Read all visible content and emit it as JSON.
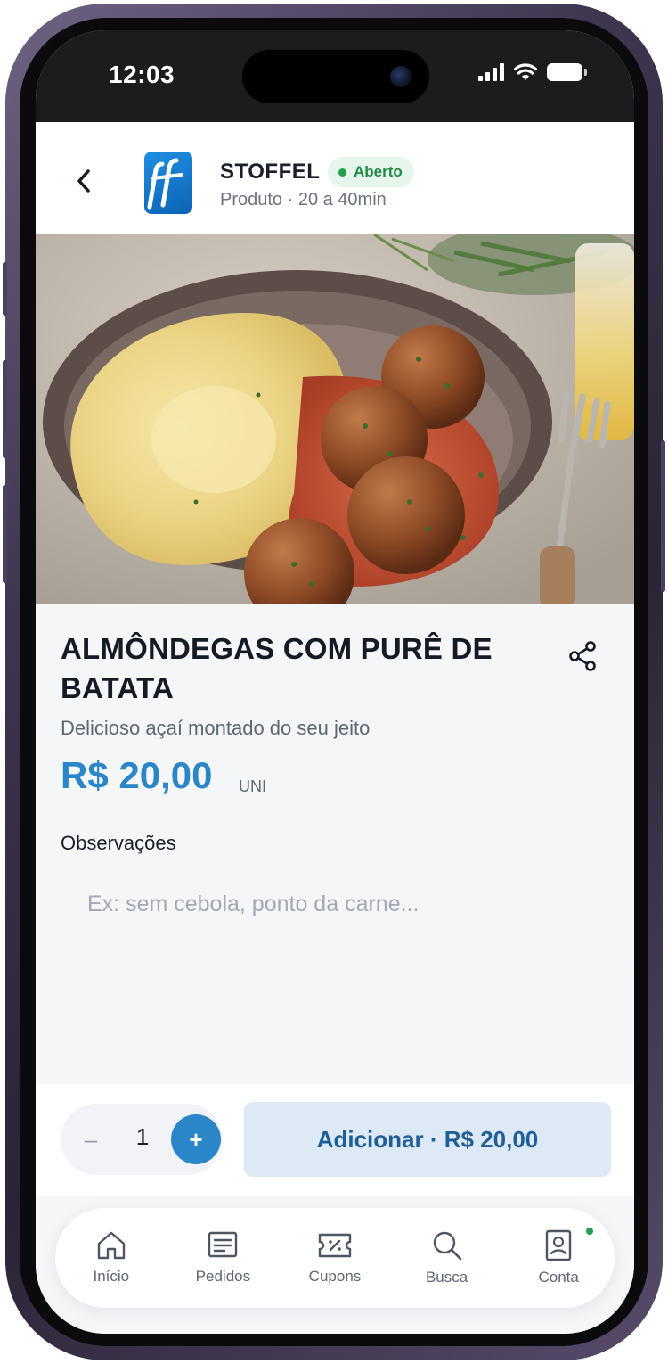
{
  "status_bar": {
    "time": "12:03"
  },
  "header": {
    "back_icon": "chevron-left-icon",
    "store_name": "STOFFEL",
    "status_label": "Aberto",
    "subtitle": "Produto · 20 a 40min",
    "colors": {
      "open_badge_bg": "#e6f6ec",
      "open_badge_text": "#1f8a44"
    }
  },
  "product": {
    "title": "ALMÔNDEGAS COM PURÊ DE BATATA",
    "description": "Delicioso açaí montado do seu jeito",
    "price": "R$ 20,00",
    "unit": "UNI",
    "share_icon": "share-icon"
  },
  "observations": {
    "label": "Observações",
    "placeholder": "Ex: sem cebola, ponto da carne..."
  },
  "cart": {
    "quantity": "1",
    "minus": "–",
    "plus": "+",
    "add_label": "Adicionar · R$ 20,00"
  },
  "tabbar": {
    "items": [
      {
        "label": "Início",
        "icon": "home-icon"
      },
      {
        "label": "Pedidos",
        "icon": "receipt-icon"
      },
      {
        "label": "Cupons",
        "icon": "coupon-icon"
      },
      {
        "label": "Busca",
        "icon": "search-icon"
      },
      {
        "label": "Conta",
        "icon": "account-icon"
      }
    ]
  },
  "colors": {
    "accent": "#2a86c6",
    "add_button_bg": "#dde9f4",
    "add_button_text": "#1f5f96"
  }
}
